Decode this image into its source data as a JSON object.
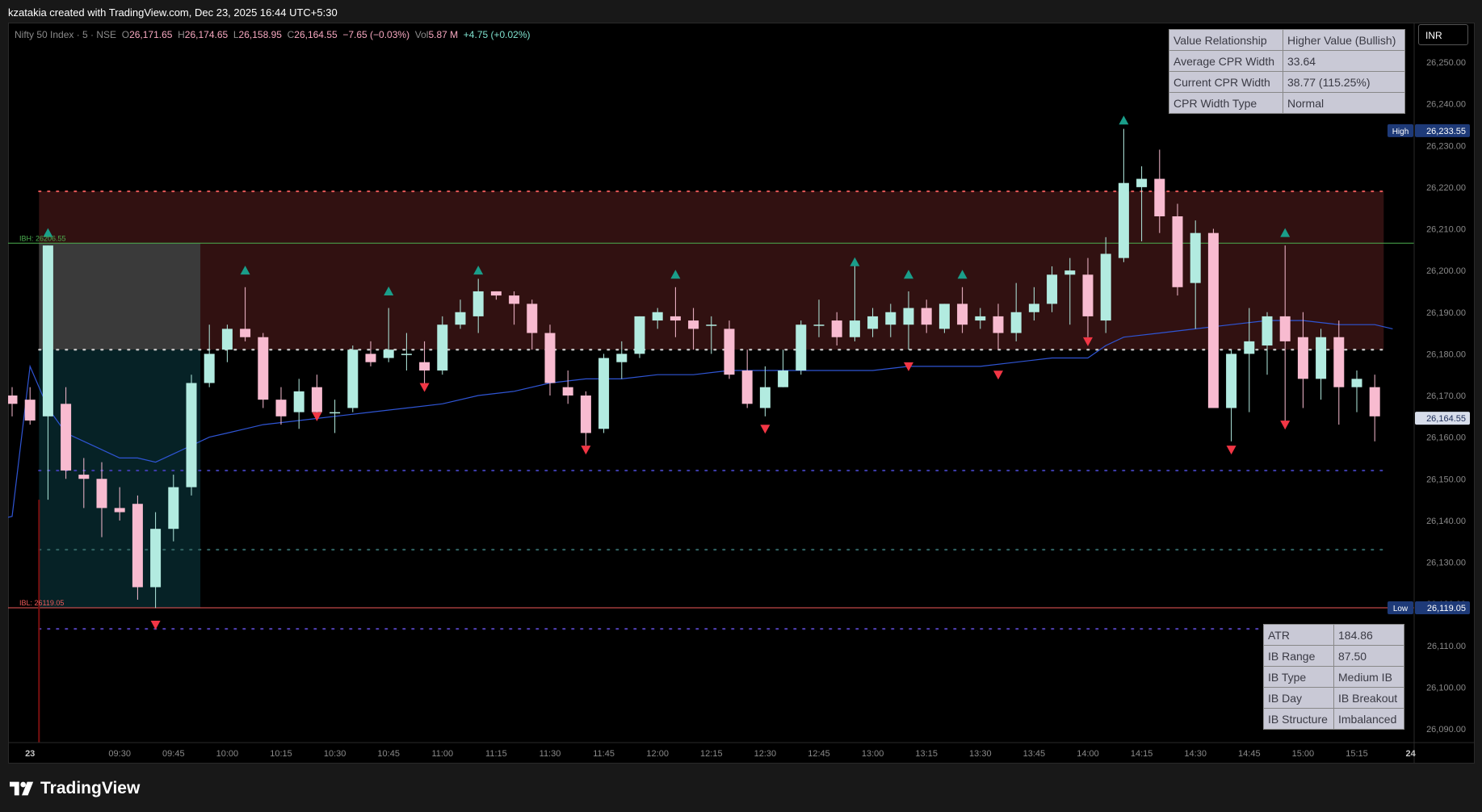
{
  "header": {
    "caption": "kzatakia created with TradingView.com, Dec 23, 2025 16:44 UTC+5:30"
  },
  "legend": {
    "symbol": "Nifty 50 Index · 5 · NSE",
    "open_label": "O",
    "open": "26,171.65",
    "high_label": "H",
    "high": "26,174.65",
    "low_label": "L",
    "low": "26,158.95",
    "close_label": "C",
    "close": "26,164.55",
    "change": "−7.65 (−0.03%)",
    "vol_label": "Vol",
    "vol": "5.87 M",
    "vol_change": "+4.75 (+0.02%)"
  },
  "currency_button": "INR",
  "cpr_table": [
    {
      "label": "Value Relationship",
      "value": "Higher Value (Bullish)"
    },
    {
      "label": "Average CPR Width",
      "value": "33.64"
    },
    {
      "label": "Current CPR Width",
      "value": "38.77 (115.25%)"
    },
    {
      "label": "CPR Width Type",
      "value": "Normal"
    }
  ],
  "ib_table": [
    {
      "label": "ATR",
      "value": "184.86"
    },
    {
      "label": "IB Range",
      "value": "87.50"
    },
    {
      "label": "IB Type",
      "value": "Medium IB"
    },
    {
      "label": "IB Day",
      "value": "IB Breakout"
    },
    {
      "label": "IB Structure",
      "value": "Imbalanced"
    }
  ],
  "footer": {
    "brand": "TradingView"
  },
  "colors": {
    "up": "#b2ebe0",
    "down": "#f8bbd0",
    "ma": "#2f55d4",
    "ib_line_high": "#4caf50",
    "ib_line_low": "#f05a5a",
    "marker_up": "#1a9e8a",
    "marker_down": "#f23645"
  },
  "chart_data": {
    "type": "candlestick",
    "title": "Nifty 50 Index · 5 · NSE",
    "ylim": [
      26085,
      26255
    ],
    "y_ticks": [
      "26,090.00",
      "26,100.00",
      "26,110.00",
      "26,120.00",
      "26,130.00",
      "26,140.00",
      "26,150.00",
      "26,160.00",
      "26,170.00",
      "26,180.00",
      "26,190.00",
      "26,200.00",
      "26,210.00",
      "26,220.00",
      "26,230.00",
      "26,240.00",
      "26,250.00"
    ],
    "y_tick_values": [
      26090,
      26100,
      26110,
      26120,
      26130,
      26140,
      26150,
      26160,
      26170,
      26180,
      26190,
      26200,
      26210,
      26220,
      26230,
      26240,
      26250
    ],
    "x_ticks": [
      {
        "i": 1,
        "label": "23"
      },
      {
        "i": 6,
        "label": "09:30"
      },
      {
        "i": 9,
        "label": "09:45"
      },
      {
        "i": 12,
        "label": "10:00"
      },
      {
        "i": 15,
        "label": "10:15"
      },
      {
        "i": 18,
        "label": "10:30"
      },
      {
        "i": 21,
        "label": "10:45"
      },
      {
        "i": 24,
        "label": "11:00"
      },
      {
        "i": 27,
        "label": "11:15"
      },
      {
        "i": 30,
        "label": "11:30"
      },
      {
        "i": 33,
        "label": "11:45"
      },
      {
        "i": 36,
        "label": "12:00"
      },
      {
        "i": 39,
        "label": "12:15"
      },
      {
        "i": 42,
        "label": "12:30"
      },
      {
        "i": 45,
        "label": "12:45"
      },
      {
        "i": 48,
        "label": "13:00"
      },
      {
        "i": 51,
        "label": "13:15"
      },
      {
        "i": 54,
        "label": "13:30"
      },
      {
        "i": 57,
        "label": "13:45"
      },
      {
        "i": 60,
        "label": "14:00"
      },
      {
        "i": 63,
        "label": "14:15"
      },
      {
        "i": 66,
        "label": "14:30"
      },
      {
        "i": 69,
        "label": "14:45"
      },
      {
        "i": 72,
        "label": "15:00"
      },
      {
        "i": 75,
        "label": "15:15"
      },
      {
        "i": 78,
        "label": "24"
      }
    ],
    "candles": [
      {
        "o": 26170,
        "h": 26172,
        "l": 26165,
        "c": 26168
      },
      {
        "o": 26169,
        "h": 26172,
        "l": 26163,
        "c": 26164
      },
      {
        "o": 26165,
        "h": 26206,
        "l": 26145,
        "c": 26206
      },
      {
        "o": 26168,
        "h": 26172,
        "l": 26150,
        "c": 26152
      },
      {
        "o": 26151,
        "h": 26155,
        "l": 26143,
        "c": 26150
      },
      {
        "o": 26150,
        "h": 26154,
        "l": 26136,
        "c": 26143
      },
      {
        "o": 26143,
        "h": 26148,
        "l": 26140,
        "c": 26142
      },
      {
        "o": 26144,
        "h": 26146,
        "l": 26121,
        "c": 26124
      },
      {
        "o": 26124,
        "h": 26142,
        "l": 26119,
        "c": 26138
      },
      {
        "o": 26138,
        "h": 26151,
        "l": 26135,
        "c": 26148
      },
      {
        "o": 26148,
        "h": 26175,
        "l": 26146,
        "c": 26173
      },
      {
        "o": 26173,
        "h": 26187,
        "l": 26172,
        "c": 26180
      },
      {
        "o": 26181,
        "h": 26187,
        "l": 26178,
        "c": 26186
      },
      {
        "o": 26186,
        "h": 26196,
        "l": 26183,
        "c": 26184
      },
      {
        "o": 26184,
        "h": 26185,
        "l": 26167,
        "c": 26169
      },
      {
        "o": 26169,
        "h": 26172,
        "l": 26163,
        "c": 26165
      },
      {
        "o": 26166,
        "h": 26174,
        "l": 26162,
        "c": 26171
      },
      {
        "o": 26172,
        "h": 26175,
        "l": 26164,
        "c": 26166
      },
      {
        "o": 26166,
        "h": 26169,
        "l": 26161,
        "c": 26166
      },
      {
        "o": 26167,
        "h": 26182,
        "l": 26166,
        "c": 26181
      },
      {
        "o": 26180,
        "h": 26183,
        "l": 26177,
        "c": 26178
      },
      {
        "o": 26179,
        "h": 26191,
        "l": 26178,
        "c": 26181
      },
      {
        "o": 26180,
        "h": 26185,
        "l": 26176,
        "c": 26180
      },
      {
        "o": 26178,
        "h": 26183,
        "l": 26172,
        "c": 26176
      },
      {
        "o": 26176,
        "h": 26189,
        "l": 26175,
        "c": 26187
      },
      {
        "o": 26187,
        "h": 26193,
        "l": 26186,
        "c": 26190
      },
      {
        "o": 26189,
        "h": 26198,
        "l": 26185,
        "c": 26195
      },
      {
        "o": 26195,
        "h": 26195,
        "l": 26193,
        "c": 26194
      },
      {
        "o": 26194,
        "h": 26195,
        "l": 26187,
        "c": 26192
      },
      {
        "o": 26192,
        "h": 26193,
        "l": 26181,
        "c": 26185
      },
      {
        "o": 26185,
        "h": 26187,
        "l": 26170,
        "c": 26173
      },
      {
        "o": 26172,
        "h": 26176,
        "l": 26168,
        "c": 26170
      },
      {
        "o": 26170,
        "h": 26171,
        "l": 26158,
        "c": 26161
      },
      {
        "o": 26162,
        "h": 26180,
        "l": 26161,
        "c": 26179
      },
      {
        "o": 26178,
        "h": 26183,
        "l": 26174,
        "c": 26180
      },
      {
        "o": 26180,
        "h": 26189,
        "l": 26179,
        "c": 26189
      },
      {
        "o": 26188,
        "h": 26191,
        "l": 26186,
        "c": 26190
      },
      {
        "o": 26189,
        "h": 26196,
        "l": 26184,
        "c": 26188
      },
      {
        "o": 26188,
        "h": 26191,
        "l": 26181,
        "c": 26186
      },
      {
        "o": 26187,
        "h": 26189,
        "l": 26180,
        "c": 26187
      },
      {
        "o": 26186,
        "h": 26188,
        "l": 26174,
        "c": 26175
      },
      {
        "o": 26176,
        "h": 26181,
        "l": 26167,
        "c": 26168
      },
      {
        "o": 26167,
        "h": 26177,
        "l": 26165,
        "c": 26172
      },
      {
        "o": 26172,
        "h": 26181,
        "l": 26172,
        "c": 26176
      },
      {
        "o": 26176,
        "h": 26188,
        "l": 26175,
        "c": 26187
      },
      {
        "o": 26187,
        "h": 26193,
        "l": 26184,
        "c": 26187
      },
      {
        "o": 26188,
        "h": 26190,
        "l": 26182,
        "c": 26184
      },
      {
        "o": 26184,
        "h": 26202,
        "l": 26183,
        "c": 26188
      },
      {
        "o": 26186,
        "h": 26191,
        "l": 26184,
        "c": 26189
      },
      {
        "o": 26187,
        "h": 26192,
        "l": 26184,
        "c": 26190
      },
      {
        "o": 26187,
        "h": 26195,
        "l": 26181,
        "c": 26191
      },
      {
        "o": 26191,
        "h": 26193,
        "l": 26185,
        "c": 26187
      },
      {
        "o": 26186,
        "h": 26192,
        "l": 26185,
        "c": 26192
      },
      {
        "o": 26192,
        "h": 26196,
        "l": 26185,
        "c": 26187
      },
      {
        "o": 26188,
        "h": 26191,
        "l": 26186,
        "c": 26189
      },
      {
        "o": 26189,
        "h": 26192,
        "l": 26181,
        "c": 26185
      },
      {
        "o": 26185,
        "h": 26197,
        "l": 26183,
        "c": 26190
      },
      {
        "o": 26190,
        "h": 26196,
        "l": 26188,
        "c": 26192
      },
      {
        "o": 26192,
        "h": 26201,
        "l": 26190,
        "c": 26199
      },
      {
        "o": 26199,
        "h": 26203,
        "l": 26187,
        "c": 26200
      },
      {
        "o": 26199,
        "h": 26203,
        "l": 26184,
        "c": 26189
      },
      {
        "o": 26188,
        "h": 26208,
        "l": 26185,
        "c": 26204
      },
      {
        "o": 26203,
        "h": 26234,
        "l": 26202,
        "c": 26221
      },
      {
        "o": 26220,
        "h": 26225,
        "l": 26207,
        "c": 26222
      },
      {
        "o": 26222,
        "h": 26229,
        "l": 26209,
        "c": 26213
      },
      {
        "o": 26213,
        "h": 26216,
        "l": 26194,
        "c": 26196
      },
      {
        "o": 26197,
        "h": 26212,
        "l": 26186,
        "c": 26209
      },
      {
        "o": 26209,
        "h": 26210,
        "l": 26167,
        "c": 26167
      },
      {
        "o": 26167,
        "h": 26181,
        "l": 26159,
        "c": 26180
      },
      {
        "o": 26180,
        "h": 26191,
        "l": 26166,
        "c": 26183
      },
      {
        "o": 26182,
        "h": 26190,
        "l": 26175,
        "c": 26189
      },
      {
        "o": 26189,
        "h": 26206,
        "l": 26162,
        "c": 26183
      },
      {
        "o": 26184,
        "h": 26190,
        "l": 26167,
        "c": 26174
      },
      {
        "o": 26174,
        "h": 26186,
        "l": 26169,
        "c": 26184
      },
      {
        "o": 26184,
        "h": 26188,
        "l": 26163,
        "c": 26172
      },
      {
        "o": 26172,
        "h": 26176,
        "l": 26166,
        "c": 26174
      },
      {
        "o": 26172,
        "h": 26175,
        "l": 26159,
        "c": 26165
      }
    ],
    "moving_average": {
      "name": "",
      "points": [
        [
          -1,
          26140
        ],
        [
          0,
          26141
        ],
        [
          1,
          26177
        ],
        [
          2,
          26167
        ],
        [
          3,
          26161
        ],
        [
          4,
          26159
        ],
        [
          5,
          26157
        ],
        [
          6,
          26155
        ],
        [
          7,
          26155
        ],
        [
          8,
          26154
        ],
        [
          9,
          26156
        ],
        [
          10,
          26158
        ],
        [
          11,
          26160
        ],
        [
          12,
          26161
        ],
        [
          13,
          26162
        ],
        [
          14,
          26163
        ],
        [
          16,
          26164
        ],
        [
          18,
          26165
        ],
        [
          20,
          26166
        ],
        [
          22,
          26167
        ],
        [
          24,
          26168
        ],
        [
          26,
          26170
        ],
        [
          28,
          26171
        ],
        [
          30,
          26173
        ],
        [
          32,
          26174
        ],
        [
          34,
          26174
        ],
        [
          36,
          26175
        ],
        [
          38,
          26175
        ],
        [
          40,
          26176
        ],
        [
          42,
          26176
        ],
        [
          44,
          26176
        ],
        [
          46,
          26176
        ],
        [
          48,
          26176
        ],
        [
          50,
          26177
        ],
        [
          52,
          26177
        ],
        [
          54,
          26177
        ],
        [
          56,
          26178
        ],
        [
          58,
          26179
        ],
        [
          60,
          26179
        ],
        [
          61,
          26182
        ],
        [
          62,
          26184
        ],
        [
          64,
          26185
        ],
        [
          66,
          26186
        ],
        [
          68,
          26187
        ],
        [
          70,
          26188
        ],
        [
          72,
          26188
        ],
        [
          74,
          26187
        ],
        [
          76,
          26187
        ],
        [
          77,
          26186
        ]
      ]
    },
    "ib_zone": {
      "start": 1.5,
      "end": 10.5,
      "high": 26206.55,
      "low": 26119.05
    },
    "ib_high_label": "IBH: 26206.55",
    "ib_low_label": "IBL: 26119.05",
    "cpr_zone": {
      "start": 1.5,
      "end": 76.5,
      "top": 26219,
      "bottom": 26181
    },
    "dotted_levels": [
      {
        "y": 26219,
        "color": "#e05555"
      },
      {
        "y": 26181,
        "color": "#c8c8c8"
      },
      {
        "y": 26152,
        "color": "#3b3ba8"
      },
      {
        "y": 26133,
        "color": "#2e5f5f"
      },
      {
        "y": 26114,
        "color": "#4b3ba8"
      }
    ],
    "markers_up": [
      [
        2,
        26209
      ],
      [
        13,
        26200
      ],
      [
        21,
        26195
      ],
      [
        26,
        26200
      ],
      [
        37,
        26199
      ],
      [
        47,
        26202
      ],
      [
        50,
        26199
      ],
      [
        53,
        26199
      ],
      [
        62,
        26236
      ],
      [
        71,
        26209
      ]
    ],
    "markers_down": [
      [
        8,
        26115
      ],
      [
        17,
        26165
      ],
      [
        23,
        26172
      ],
      [
        32,
        26157
      ],
      [
        42,
        26162
      ],
      [
        50,
        26177
      ],
      [
        55,
        26175
      ],
      [
        60,
        26183
      ],
      [
        68,
        26157
      ],
      [
        71,
        26163
      ]
    ],
    "last_price": "26,164.55",
    "last_price_value": 26164.55,
    "high_label": "High",
    "high_value_text": "26,233.55",
    "high_value": 26233.55,
    "low_label": "Low",
    "low_value_text": "26,119.05",
    "low_value": 26119.05
  }
}
